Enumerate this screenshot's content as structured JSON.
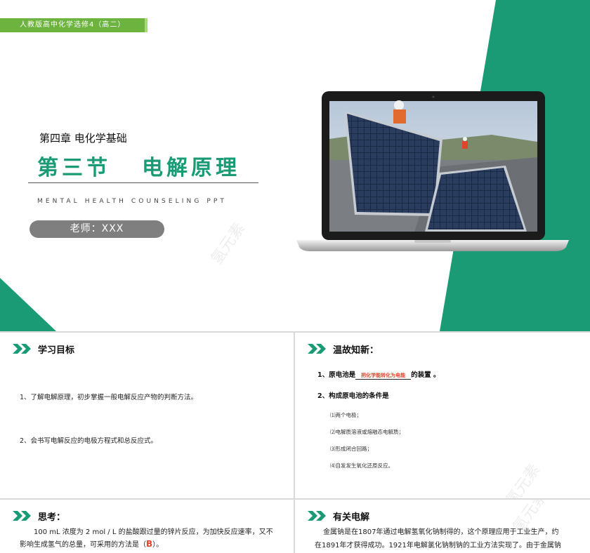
{
  "cover": {
    "tag": "人教版高中化学选修4（高二）",
    "chapter": "第四章 电化学基础",
    "section_num": "第三节",
    "section_name": "电解原理",
    "subtitle_en": "MENTAL HEALTH COUNSELING PPT",
    "teacher": "老师：XXX",
    "watermark": "氢元素",
    "colors": {
      "green": "#1a9b75",
      "tag_green": "#6db33f",
      "pill_gray": "#7f7f7f"
    }
  },
  "goals": {
    "title": "学习目标",
    "items": [
      "1、了解电解原理，初步掌握一般电解反应产物的判断方法。",
      "2、会书写电解反应的电极方程式和总反应式。"
    ]
  },
  "review": {
    "title": "温故知新：",
    "q1_prefix": "1、原电池是",
    "q1_answer": "把化学能转化为电能",
    "q1_suffix": "的装置 。",
    "q2": "2、构成原电池的条件是",
    "conditions": [
      "⑴两个电极；",
      "⑵电解质溶液或熔融态电解质；",
      "⑶形成闭合回路；",
      "⑷自发发生氧化还原反应。"
    ]
  },
  "think": {
    "title": "思考：",
    "line1": "100 mL 浓度为 2 mol / L 的盐酸跟过量的锌片反应，为加快反应速率，又不",
    "line2_prefix": "影响生成氢气的总量，可采用的方法是（",
    "answer": "B",
    "line2_suffix": "）。"
  },
  "electrolysis": {
    "title": "有关电解",
    "line1": "金属钠是在1807年通过电解氢氧化钠制得的，这个原理应用于工业生产，约",
    "line2": "在1891年才获得成功。1921年电解氯化钠制钠的工业方法实现了。由于金属钠"
  }
}
